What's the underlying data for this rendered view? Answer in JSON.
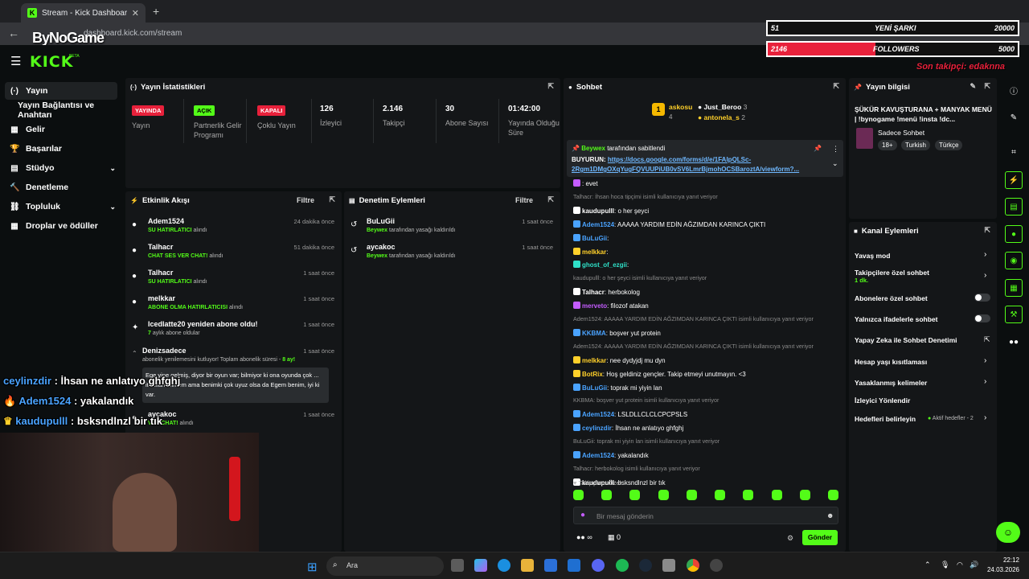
{
  "browser": {
    "tab_title": "Stream - Kick Dashboard",
    "tab_close": "✕",
    "new_tab": "+",
    "url": "dashboard.kick.com/stream"
  },
  "overlay": {
    "watermark": "ByNoGame",
    "bar1_left": "51",
    "bar1_mid": "YENİ ŞARKI",
    "bar1_right": "20000",
    "bar2_left": "2146",
    "bar2_mid": "FOLLOWERS",
    "bar2_right": "5000",
    "bar2_progress": 0.43,
    "last_follower": "Son takipçi: edaknna",
    "chat": [
      {
        "user": "ceylinzdir",
        "text": " : İhsan ne anlatıyo ghfghj",
        "color": "#4aa3ff"
      },
      {
        "user": "Adem1524",
        "text": " : yakalandık",
        "color": "#4aa3ff"
      },
      {
        "user": "kaudupulll",
        "text": " : bsksndlnzl bir tık",
        "color": "#4aa3ff"
      }
    ]
  },
  "header": {
    "logo": "KICK",
    "beta": "BETA"
  },
  "nav": {
    "items": [
      {
        "label": "Yayın",
        "icon": "(·)"
      },
      {
        "label": "Yayın Bağlantısı ve Anahtarı",
        "icon": ""
      },
      {
        "label": "Gelir",
        "icon": "▦"
      },
      {
        "label": "Başarılar",
        "icon": "🏆"
      },
      {
        "label": "Stüdyo",
        "icon": "▤"
      },
      {
        "label": "Denetleme",
        "icon": "🔨"
      },
      {
        "label": "Topluluk",
        "icon": "⛓"
      },
      {
        "label": "Droplar ve ödüller",
        "icon": "▦"
      }
    ]
  },
  "stats": {
    "title": "Yayın İstatistikleri",
    "items": [
      {
        "badge": "YAYINDA",
        "label": "Yayın"
      },
      {
        "badge": "AÇIK",
        "label": "Partnerlik Gelir Programı"
      },
      {
        "badge": "KAPALI",
        "label": "Çoklu Yayın"
      },
      {
        "value": "126",
        "label": "İzleyici"
      },
      {
        "value": "2.146",
        "label": "Takipçi"
      },
      {
        "value": "30",
        "label": "Abone Sayısı"
      },
      {
        "value": "01:42:00",
        "label": "Yayında Olduğu Süre"
      }
    ]
  },
  "activity": {
    "title": "Etkinlik Akışı",
    "filter": "Filtre",
    "events": [
      {
        "name": "Adem1524",
        "sub": "SU HATIRLATICI",
        "suffix": " alındı",
        "time": "24 dakika önce"
      },
      {
        "name": "Talhacr",
        "sub": "CHAT SES VER CHAT!",
        "suffix": " alındı",
        "time": "51 dakika önce"
      },
      {
        "name": "Talhacr",
        "sub": "SU HATIRLATICI",
        "suffix": " alındı",
        "time": "1 saat önce"
      },
      {
        "name": "melkkar",
        "sub": "ABONE OLMA HATIRLATICISI",
        "suffix": " alındı",
        "time": "1 saat önce"
      },
      {
        "name": "Icedlatte20 yeniden abone oldu!",
        "sub": "7",
        "suffix": " aylık abone oldular",
        "time": "1 saat önce"
      }
    ],
    "expanded": {
      "name": "Denizsadece",
      "time": "1 saat önce",
      "sub": "abonelik yenilemesini kutluyor! Toplam abonelik süresi - ",
      "months": "8 ay!",
      "message": "Ege yine gelmiş, diyor bir oyun var; bilmiyor ki ona oyunda çok ... itirafları bilmem ama benimki çok uyuz olsa da Egem benim, iyi ki var."
    },
    "last": {
      "name": "aycakoc",
      "sub": "VER CHAT!",
      "suffix": " alındı",
      "time": "1 saat önce"
    }
  },
  "mod": {
    "title": "Denetim Eylemleri",
    "filter": "Filtre",
    "items": [
      {
        "name": "BuLuGii",
        "by": "Beywex",
        "suffix": " tarafından yasağı kaldırıldı",
        "time": "1 saat önce"
      },
      {
        "name": "aycakoc",
        "by": "Beywex",
        "suffix": " tarafından yasağı kaldırıldı",
        "time": "1 saat önce"
      }
    ]
  },
  "chat": {
    "title": "Sohbet",
    "leaders": {
      "first": "askosu",
      "first_count": "4",
      "second": "Just_Beroo",
      "second_count": "3",
      "third": "antonela_s",
      "third_count": "2",
      "rank": "1"
    },
    "pinned_by": "Beywex",
    "pinned_suffix": " tarafından sabitlendi",
    "pinned_text": "BUYURUN: ",
    "pinned_link": "https://docs.google.com/forms/d/e/1FAIpQLSc-2Rgm1DMgOXqYugFQVUUPiUB0vSV6LmrBjmohOCSBaroztA/viewform?...",
    "messages": [
      {
        "kind": "msg",
        "user": "",
        "text": ": evet",
        "ucolor": "#c45cff"
      },
      {
        "kind": "reply",
        "text": "Talhacr: İhsan hoca tipçimi isimli kullanıcıya yanıt veriyor"
      },
      {
        "kind": "msg",
        "user": "kaudupulll",
        "text": ": o her şeyci",
        "ucolor": "#ffffff"
      },
      {
        "kind": "msg",
        "user": "Adem1524",
        "text": ": AAAAA YARDIM EDİN AĞZIMDAN KARINCA ÇIKTI",
        "ucolor": "#4aa3ff"
      },
      {
        "kind": "msg",
        "user": "BuLuGii",
        "text": ":",
        "ucolor": "#4aa3ff"
      },
      {
        "kind": "msg",
        "user": "melkkar",
        "text": ":",
        "ucolor": "#ffd02a"
      },
      {
        "kind": "msg",
        "user": "ghost_of_ezgii",
        "text": ":",
        "ucolor": "#2fe0c8"
      },
      {
        "kind": "reply",
        "text": "kaudupulll: o her şeyci isimli kullanıcıya yanıt veriyor"
      },
      {
        "kind": "msg",
        "user": "Talhacr",
        "text": ": herbokolog",
        "ucolor": "#ffffff"
      },
      {
        "kind": "msg",
        "user": "merveto",
        "text": ": filozof atakan",
        "ucolor": "#c45cff"
      },
      {
        "kind": "reply",
        "text": "Adem1524: AAAAA YARDIM EDİN AĞZIMDAN KARINCA ÇIKTI isimli kullanıcıya yanıt veriyor"
      },
      {
        "kind": "msg",
        "user": "KKBMA",
        "text": ": boşver yut protein",
        "ucolor": "#4aa3ff"
      },
      {
        "kind": "reply",
        "text": "Adem1524: AAAAA YARDIM EDİN AĞZIMDAN KARINCA ÇIKTI isimli kullanıcıya yanıt veriyor"
      },
      {
        "kind": "msg",
        "user": "melkkar",
        "text": ": nee dydyjdj mu dyn",
        "ucolor": "#ffd02a"
      },
      {
        "kind": "msg",
        "user": "BotRix",
        "text": ": Hoş geldiniz gençler. Takip etmeyi unutmayın. <3",
        "ucolor": "#ffd02a"
      },
      {
        "kind": "msg",
        "user": "BuLuGii",
        "text": ": toprak mi yiyin lan",
        "ucolor": "#4aa3ff"
      },
      {
        "kind": "reply",
        "text": "KKBMA: boşver yut protein isimli kullanıcıya yanıt veriyor"
      },
      {
        "kind": "msg",
        "user": "Adem1524",
        "text": ": LSLDLLCLCLCPCPSLS",
        "ucolor": "#4aa3ff"
      },
      {
        "kind": "msg",
        "user": "ceylinzdir",
        "text": ": İhsan ne anlatıyo ghfghj",
        "ucolor": "#4aa3ff"
      },
      {
        "kind": "reply",
        "text": "BuLuGii: toprak mi yiyin lan isimli kullanıcıya yanıt veriyor"
      },
      {
        "kind": "msg",
        "user": "Adem1524",
        "text": ": yakalandık",
        "ucolor": "#4aa3ff"
      },
      {
        "kind": "reply",
        "text": "Talhacr: herbokolog isimli kullanıcıya yanıt veriyor"
      },
      {
        "kind": "msg",
        "user": "kaudupulll",
        "text": ": bsksndlnzl bir tık",
        "ucolor": "#ffffff"
      }
    ],
    "followers_only": "Takipçilere Özel",
    "input_placeholder": "Bir mesaj gönderin",
    "points": "∞",
    "count": "0",
    "send": "Gönder"
  },
  "stream_info": {
    "title": "Yayın bilgisi",
    "stream_title": "ŞÜKÜR KAVUŞTURANA + MANYAK MENÜ | !bynogame !menü !insta !dc...",
    "category": "Sadece Sohbet",
    "tags": [
      "18+",
      "Turkish",
      "Türkçe"
    ]
  },
  "channel": {
    "title": "Kanal Eylemleri",
    "rows": [
      {
        "label": "Yavaş mod",
        "control": "chev"
      },
      {
        "label": "Takipçilere özel sohbet",
        "sub": "1 dk.",
        "control": "chev"
      },
      {
        "label": "Abonelere özel sohbet",
        "control": "toggle"
      },
      {
        "label": "Yalnızca ifadelerle sohbet",
        "control": "toggle"
      },
      {
        "label": "Yapay Zeka ile Sohbet Denetimi",
        "control": "ext"
      },
      {
        "label": "Hesap yaşı kısıtlaması",
        "control": "chev"
      },
      {
        "label": "Yasaklanmış kelimeler",
        "control": "chev"
      },
      {
        "label": "İzleyici Yönlendir",
        "control": "none"
      },
      {
        "label": "Hedefleri belirleyin",
        "control": "chev",
        "extra": "Aktif hedefler - 2"
      }
    ]
  },
  "taskbar": {
    "search": "Ara",
    "time": "22:12",
    "date": "24.03.2026"
  },
  "colors": {
    "kick_green": "#53fc18",
    "live_red": "#e8213b",
    "panel": "#141618"
  }
}
